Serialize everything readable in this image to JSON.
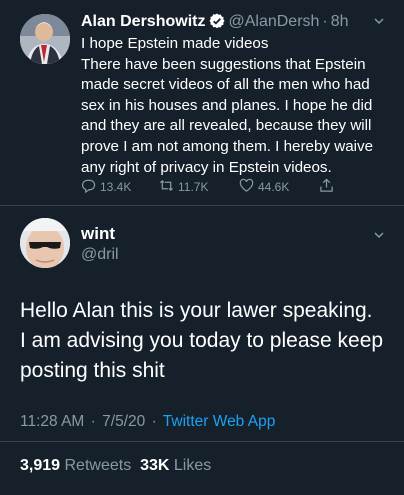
{
  "quoted_tweet": {
    "author_name": "Alan Dershowitz",
    "handle": "@AlanDersh",
    "separator": "·",
    "time": "8h",
    "body_lines": [
      "I hope Epstein made videos",
      "There have been suggestions that Epstein",
      "made secret videos of all the men who had",
      "sex in his houses and planes. I hope he did",
      "and they are all revealed, because they will",
      "prove I am not among them. I hereby waive",
      "any right of privacy in Epstein videos."
    ],
    "replies": "13.4K",
    "retweets": "11.7K",
    "likes": "44.6K"
  },
  "main_tweet": {
    "author_name": "wint",
    "handle": "@dril",
    "body_lines": [
      "Hello Alan this is your lawer speaking.",
      "I am advising you today to please keep",
      "posting this shit"
    ],
    "time": "11:28 AM",
    "date": "7/5/20",
    "app": "Twitter Web App",
    "meta_separator": "·",
    "retweet_count": "3,919",
    "retweet_label": "Retweets",
    "like_count": "33K",
    "like_label": "Likes"
  },
  "colors": {
    "background": "#15202b",
    "secondary_text": "#8899a6",
    "accent": "#1da1f2",
    "divider": "#38444d"
  }
}
